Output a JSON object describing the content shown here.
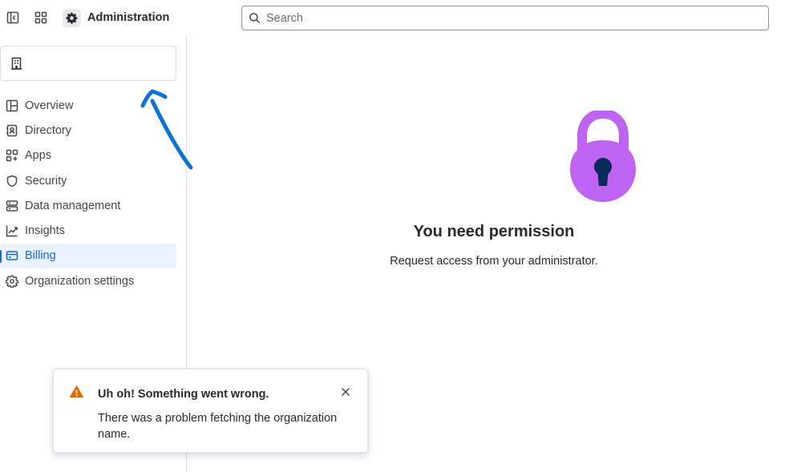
{
  "header": {
    "product_name": "Administration",
    "search_placeholder": "Search",
    "icons": [
      "sidebar-toggle-icon",
      "app-switcher-icon",
      "gear-icon",
      "search-icon"
    ]
  },
  "sidebar": {
    "org_switcher": {
      "icon": "building-icon",
      "name": ""
    },
    "items": [
      {
        "label": "Overview",
        "icon": "overview-icon",
        "active": false
      },
      {
        "label": "Directory",
        "icon": "directory-icon",
        "active": false
      },
      {
        "label": "Apps",
        "icon": "apps-icon",
        "active": false
      },
      {
        "label": "Security",
        "icon": "shield-icon",
        "active": false
      },
      {
        "label": "Data management",
        "icon": "database-icon",
        "active": false
      },
      {
        "label": "Insights",
        "icon": "chart-line-icon",
        "active": false
      },
      {
        "label": "Billing",
        "icon": "credit-card-icon",
        "active": true
      },
      {
        "label": "Organization settings",
        "icon": "gear-icon",
        "active": false
      }
    ]
  },
  "main": {
    "illustration": "padlock-icon",
    "title": "You need permission",
    "subtitle": "Request access from your administrator."
  },
  "flag": {
    "icon": "warning-icon",
    "title": "Uh oh! Something went wrong.",
    "body": "There was a problem fetching the organization name."
  },
  "colors": {
    "accent": "#1868db",
    "active_bg": "#e9f2fe",
    "lock_purple": "#bf63f3",
    "lock_keyhole": "#0a2a57",
    "warning": "#e06c00",
    "annotation": "#0b72d6"
  }
}
